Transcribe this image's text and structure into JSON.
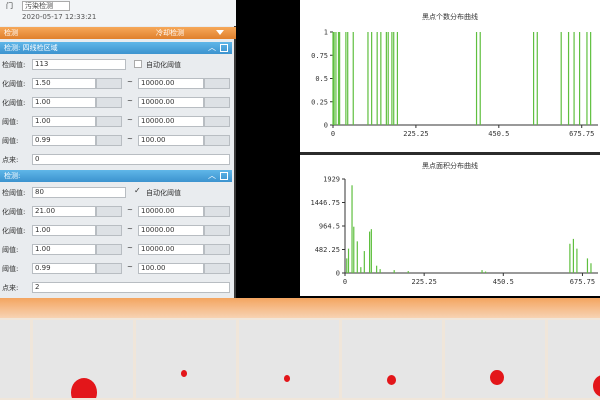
{
  "top_field": {
    "label": "门",
    "value": "污染检测",
    "time": "2020-05-17 12:33:21"
  },
  "orange_bar": {
    "left": "检测",
    "right": "冷却检测"
  },
  "section1": {
    "title": "检测: 四线检区域",
    "rows": [
      {
        "label": "检阈值:",
        "value": "113",
        "checkbox_label": "自动化阈值"
      },
      {
        "label": "化阈值:",
        "min": "1.50",
        "max": "10000.00"
      },
      {
        "label": "化阈值:",
        "min": "1.00",
        "max": "10000.00"
      },
      {
        "label": "阈值:",
        "min": "1.00",
        "max": "10000.00"
      },
      {
        "label": "阈值:",
        "min": "0.99",
        "max": "100.00"
      },
      {
        "label": "点来:",
        "value": "0"
      }
    ]
  },
  "section2": {
    "title": "检测:",
    "rows": [
      {
        "label": "检阈值:",
        "value": "80",
        "checkbox_label": "自动化阈值"
      },
      {
        "label": "化阈值:",
        "min": "21.00",
        "max": "10000.00"
      },
      {
        "label": "化阈值:",
        "min": "1.00",
        "max": "10000.00"
      },
      {
        "label": "阈值:",
        "min": "1.00",
        "max": "10000.00"
      },
      {
        "label": "阈值:",
        "min": "0.99",
        "max": "100.00"
      },
      {
        "label": "点来:",
        "value": "2"
      }
    ]
  },
  "chart_data": [
    {
      "type": "line",
      "title": "黑点个数分布曲线",
      "ylim": [
        0,
        1
      ],
      "y_ticks": [
        "1",
        "0.75",
        "0.5",
        "0.25",
        "0"
      ],
      "x_ticks": [
        "0",
        "225.25",
        "450.5",
        "675.75"
      ],
      "xlim": [
        0,
        720
      ],
      "series": [
        {
          "spikes": [
            0,
            3,
            8,
            15,
            18,
            35,
            40,
            55,
            95,
            105,
            120,
            130,
            145,
            150,
            160,
            165,
            175,
            390,
            400,
            545,
            555,
            620,
            640,
            655,
            670,
            690,
            700
          ],
          "values": [
            1,
            1,
            1,
            1,
            1,
            1,
            1,
            1,
            1,
            1,
            1,
            1,
            1,
            1,
            1,
            1,
            1,
            1,
            1,
            1,
            1,
            1,
            1,
            1,
            1,
            1,
            1
          ]
        }
      ],
      "color": "#5fbf3f"
    },
    {
      "type": "line",
      "title": "黑点面积分布曲线",
      "ylim": [
        0,
        1929
      ],
      "y_ticks": [
        "1929",
        "1446.75",
        "964.5",
        "482.25",
        "0"
      ],
      "x_ticks": [
        "0",
        "225.25",
        "450.5",
        "675.75"
      ],
      "xlim": [
        0,
        720
      ],
      "series": [
        {
          "spikes": [
            5,
            10,
            20,
            25,
            35,
            45,
            55,
            70,
            75,
            90,
            100,
            140,
            180,
            390,
            400,
            640,
            650,
            660,
            690,
            700
          ],
          "values": [
            300,
            500,
            1800,
            950,
            650,
            120,
            450,
            850,
            900,
            150,
            80,
            60,
            40,
            60,
            30,
            600,
            700,
            500,
            300,
            200
          ]
        }
      ],
      "color": "#5fbf3f"
    }
  ],
  "thumbnails": [
    {
      "blob": false
    },
    {
      "blob": true
    },
    {
      "blob": true
    },
    {
      "blob": true
    },
    {
      "blob": true
    },
    {
      "blob": true
    },
    {
      "blob": true
    }
  ]
}
